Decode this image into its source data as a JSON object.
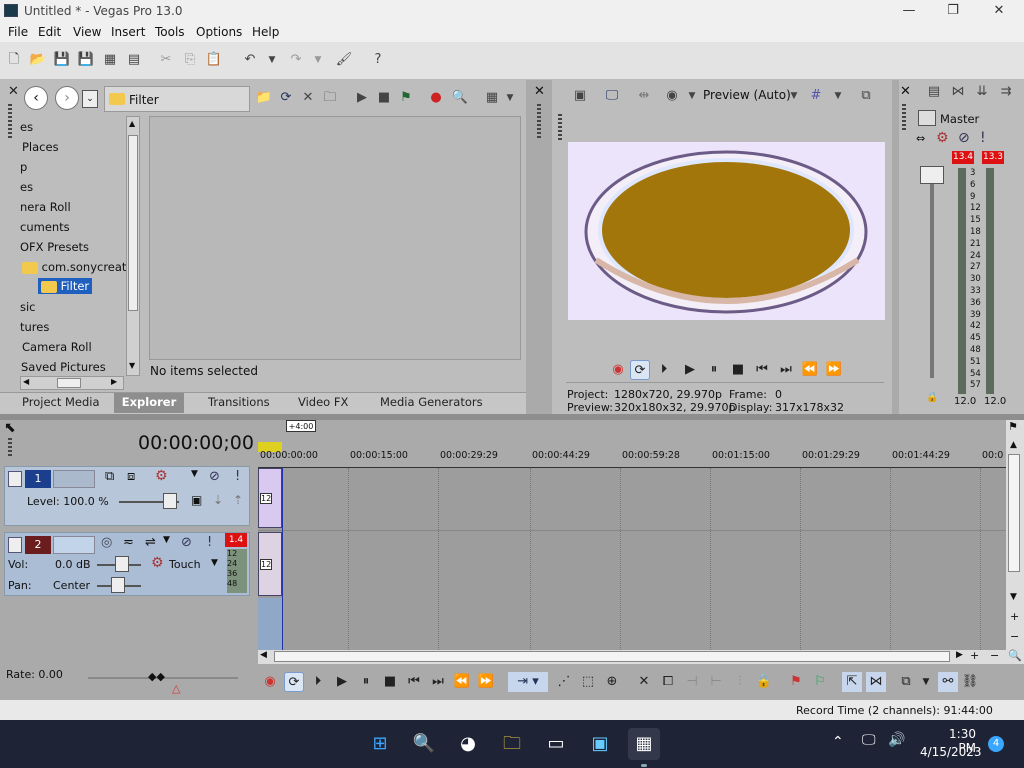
{
  "window": {
    "title": "Untitled * - Vegas Pro 13.0",
    "minimize": "—",
    "maximize": "❐",
    "close": "✕"
  },
  "menu": [
    "File",
    "Edit",
    "View",
    "Insert",
    "Tools",
    "Options",
    "Help"
  ],
  "explorer": {
    "path": "Filter",
    "tree": [
      "es",
      "Places",
      "p",
      "es",
      "nera Roll",
      "cuments",
      "OFX Presets",
      "com.sonycreativ",
      "Filter",
      "sic",
      "tures",
      "Camera Roll",
      "Saved Pictures"
    ],
    "status": "No items selected",
    "tabs": [
      "Project Media",
      "Explorer",
      "Transitions",
      "Video FX",
      "Media Generators"
    ]
  },
  "preview": {
    "mode": "Preview (Auto)",
    "project": "Project:",
    "project_val": "1280x720, 29.970p",
    "preview": "Preview:",
    "preview_val": "320x180x32, 29.970p",
    "frame": "Frame:",
    "frame_val": "0",
    "display": "Display:",
    "display_val": "317x178x32"
  },
  "master": {
    "title": "Master",
    "peak_l": "13.4",
    "peak_r": "13.3",
    "scale": [
      "3",
      "6",
      "9",
      "12",
      "15",
      "18",
      "21",
      "24",
      "27",
      "30",
      "33",
      "36",
      "39",
      "42",
      "45",
      "48",
      "51",
      "54",
      "57"
    ],
    "foot_l": "12.0",
    "foot_r": "12.0"
  },
  "timeline": {
    "timecode": "00:00:00;00",
    "marker": "+4:00",
    "ruler": [
      "00:00:00:00",
      "00:00:15:00",
      "00:00:29:29",
      "00:00:44:29",
      "00:00:59:28",
      "00:01:15:00",
      "00:01:29:29",
      "00:01:44:29",
      "00:0"
    ],
    "track1": {
      "num": "1",
      "level": "Level: 100.0 %"
    },
    "track2": {
      "num": "2",
      "badge": "1.4",
      "vol_label": "Vol:",
      "vol": "0.0 dB",
      "pan_label": "Pan:",
      "pan": "Center",
      "mode": "Touch",
      "meter": [
        "12",
        "24",
        "36",
        "48"
      ]
    },
    "clip_label": "12",
    "rate": "Rate: 0.00"
  },
  "status": {
    "record": "Record Time (2 channels): 91:44:00"
  },
  "taskbar": {
    "time": "1:30 PM",
    "date": "4/15/2023",
    "badge": "4"
  }
}
